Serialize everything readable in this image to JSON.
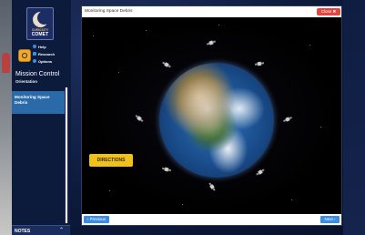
{
  "sidebar": {
    "logo_line1": "CURIOSITY",
    "logo_line2": "COMET",
    "links": [
      {
        "label": "Help",
        "icon": "help-icon"
      },
      {
        "label": "Research",
        "icon": "research-icon"
      },
      {
        "label": "Options",
        "icon": "options-icon"
      }
    ],
    "section_title": "Mission Control",
    "section_subtitle": "Orientation",
    "nav_items": [
      {
        "label": "Monitoring Space Debris",
        "active": true
      }
    ],
    "notes_label": "NOTES",
    "notes_icon": "chevron-up-icon"
  },
  "activity": {
    "title": "Monitoring Space Debris",
    "close_label": "Close",
    "close_icon": "close-icon",
    "directions_label": "DIRECTIONS",
    "prev_label": "Previous",
    "next_label": "Next"
  },
  "colors": {
    "sidebar_bg": "#0c1b3c",
    "nav_active": "#2b6aa8",
    "close_red": "#e2463f",
    "directions_yellow": "#f2c21c",
    "nav_button_blue": "#3b8de3"
  }
}
